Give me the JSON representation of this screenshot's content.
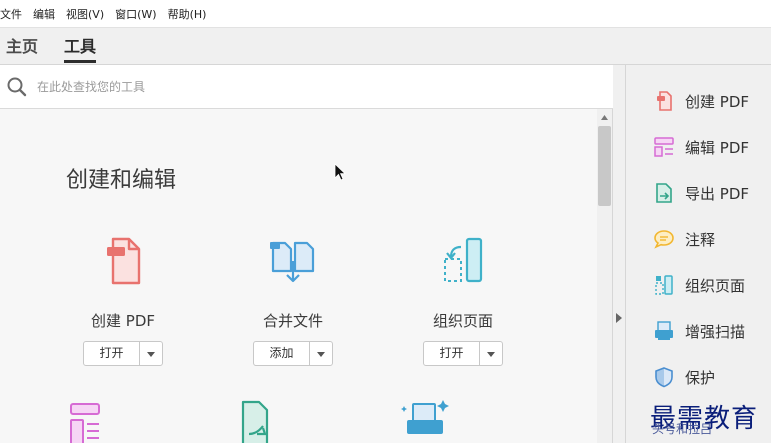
{
  "menu": [
    "文件",
    "编辑",
    "视图(V)",
    "窗口(W)",
    "帮助(H)"
  ],
  "tabs": {
    "home": "主页",
    "tools": "工具"
  },
  "search": {
    "placeholder": "在此处查找您的工具"
  },
  "section": {
    "title": "创建和编辑"
  },
  "tools": [
    {
      "name": "创建 PDF",
      "button": "打开",
      "icon": "create-pdf-icon",
      "color": "#e8726e"
    },
    {
      "name": "合并文件",
      "button": "添加",
      "icon": "combine-files-icon",
      "color": "#4a9fd8"
    },
    {
      "name": "组织页面",
      "button": "打开",
      "icon": "organize-pages-icon",
      "color": "#3fb1c9"
    }
  ],
  "sidebar": {
    "items": [
      {
        "label": "创建 PDF",
        "icon": "create-pdf-icon",
        "color": "#e8726e"
      },
      {
        "label": "编辑 PDF",
        "icon": "edit-pdf-icon",
        "color": "#d66bd4"
      },
      {
        "label": "导出 PDF",
        "icon": "export-pdf-icon",
        "color": "#33a58a"
      },
      {
        "label": "注释",
        "icon": "comment-icon",
        "color": "#f2b731"
      },
      {
        "label": "组织页面",
        "icon": "organize-pages-icon",
        "color": "#3fb1c9"
      },
      {
        "label": "增强扫描",
        "icon": "enhance-scan-icon",
        "color": "#3fa0d0"
      },
      {
        "label": "保护",
        "icon": "protect-icon",
        "color": "#4a8ed0"
      }
    ]
  },
  "watermark": {
    "main": "最需教育",
    "sub": "头号和拉吕"
  }
}
